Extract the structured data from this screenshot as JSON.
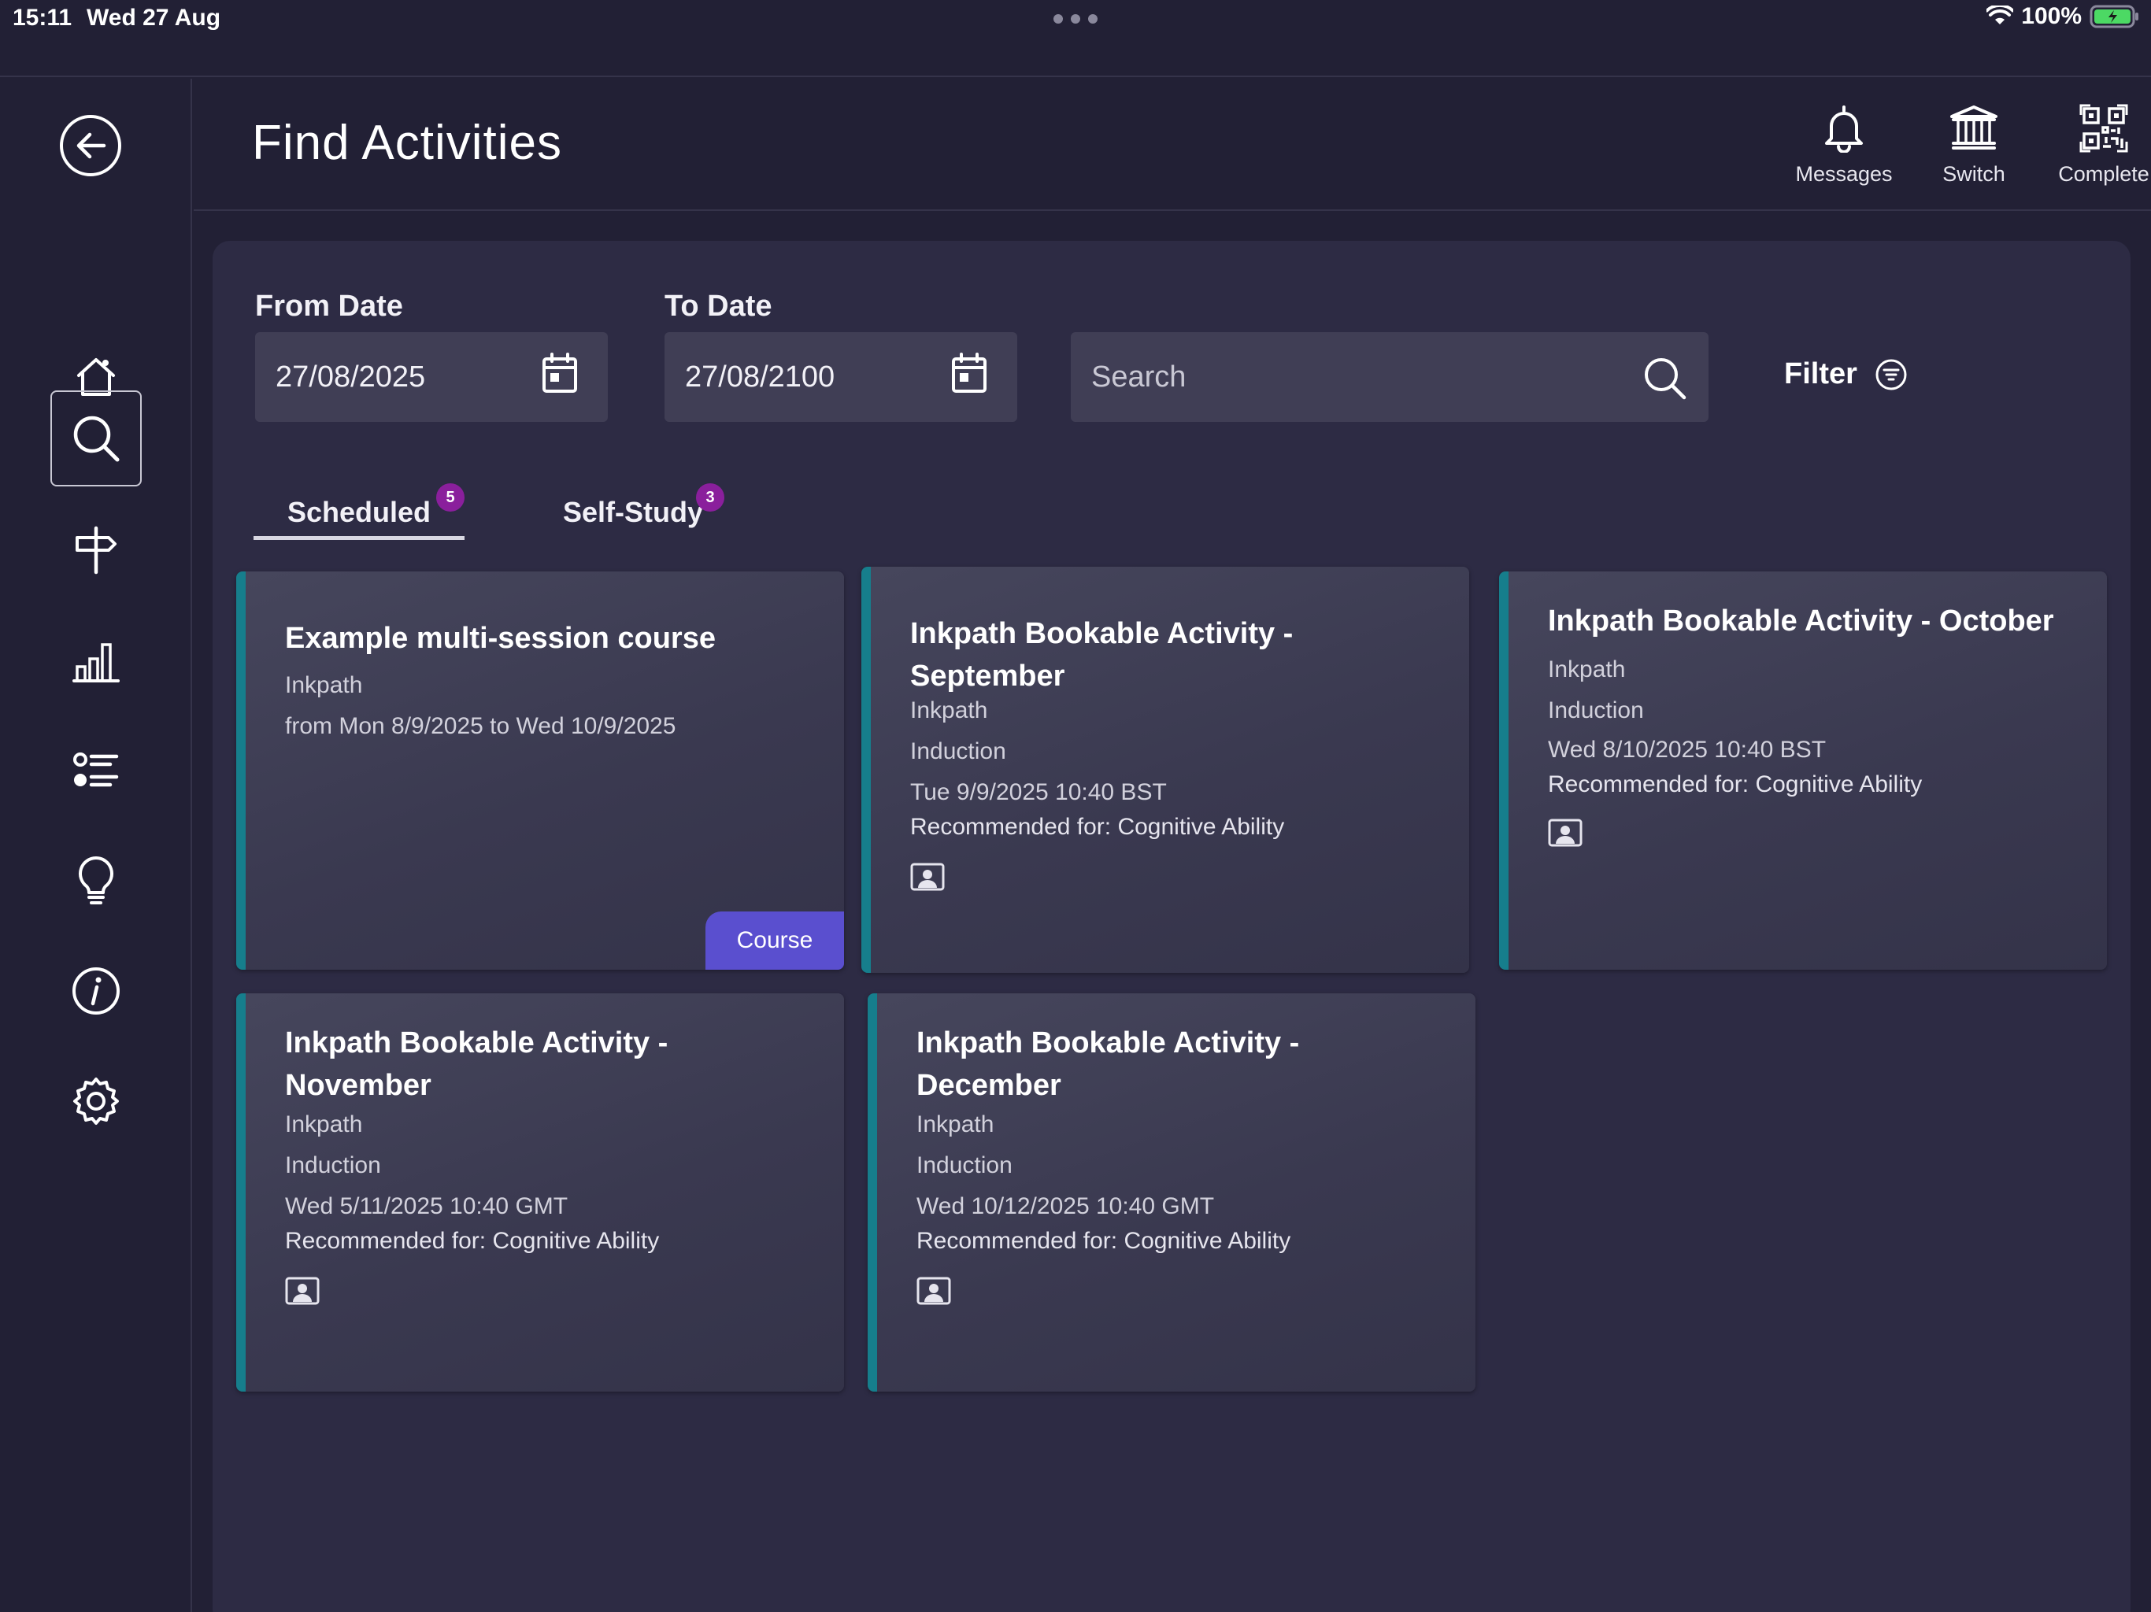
{
  "status_bar": {
    "time": "15:11",
    "date": "Wed 27 Aug",
    "battery": "100%"
  },
  "header": {
    "title": "Find Activities",
    "actions": [
      {
        "label": "Messages",
        "icon": "bell-icon"
      },
      {
        "label": "Switch",
        "icon": "institution-icon"
      },
      {
        "label": "Complete",
        "icon": "qr-code-icon"
      }
    ]
  },
  "sidebar": {
    "items": [
      {
        "name": "home",
        "icon": "home-icon"
      },
      {
        "name": "search",
        "icon": "search-icon",
        "active": true
      },
      {
        "name": "signpost",
        "icon": "signpost-icon"
      },
      {
        "name": "stats",
        "icon": "bar-chart-icon"
      },
      {
        "name": "list",
        "icon": "list-icon"
      },
      {
        "name": "ideas",
        "icon": "lightbulb-icon"
      },
      {
        "name": "info",
        "icon": "info-icon"
      },
      {
        "name": "settings",
        "icon": "gear-icon"
      }
    ]
  },
  "filters": {
    "from_label": "From Date",
    "from_value": "27/08/2025",
    "to_label": "To Date",
    "to_value": "27/08/2100",
    "search_placeholder": "Search",
    "filter_label": "Filter"
  },
  "tabs": [
    {
      "label": "Scheduled",
      "count": "5",
      "active": true
    },
    {
      "label": "Self-Study",
      "count": "3",
      "active": false
    }
  ],
  "cards": [
    {
      "title": "Example multi-session course",
      "provider": "Inkpath",
      "when": "from Mon 8/9/2025 to Wed 10/9/2025",
      "tag": "Course"
    },
    {
      "title": "Inkpath Bookable Activity - September",
      "provider": "Inkpath",
      "category": "Induction",
      "when": "Tue 9/9/2025 10:40 BST",
      "recommended": "Recommended for: Cognitive Ability"
    },
    {
      "title": "Inkpath Bookable Activity - October",
      "provider": "Inkpath",
      "category": "Induction",
      "when": "Wed 8/10/2025 10:40 BST",
      "recommended": "Recommended for: Cognitive Ability"
    },
    {
      "title": "Inkpath Bookable Activity - November",
      "provider": "Inkpath",
      "category": "Induction",
      "when": "Wed 5/11/2025 10:40 GMT",
      "recommended": "Recommended for: Cognitive Ability"
    },
    {
      "title": "Inkpath Bookable Activity - December",
      "provider": "Inkpath",
      "category": "Induction",
      "when": "Wed 10/12/2025 10:40 GMT",
      "recommended": "Recommended for: Cognitive Ability"
    }
  ],
  "colors": {
    "background": "#222035",
    "panel": "#2d2b44",
    "card_accent": "#167e8c",
    "badge": "#8a1f9c",
    "course_tag": "#5a4fcf",
    "battery": "#4cd964"
  }
}
